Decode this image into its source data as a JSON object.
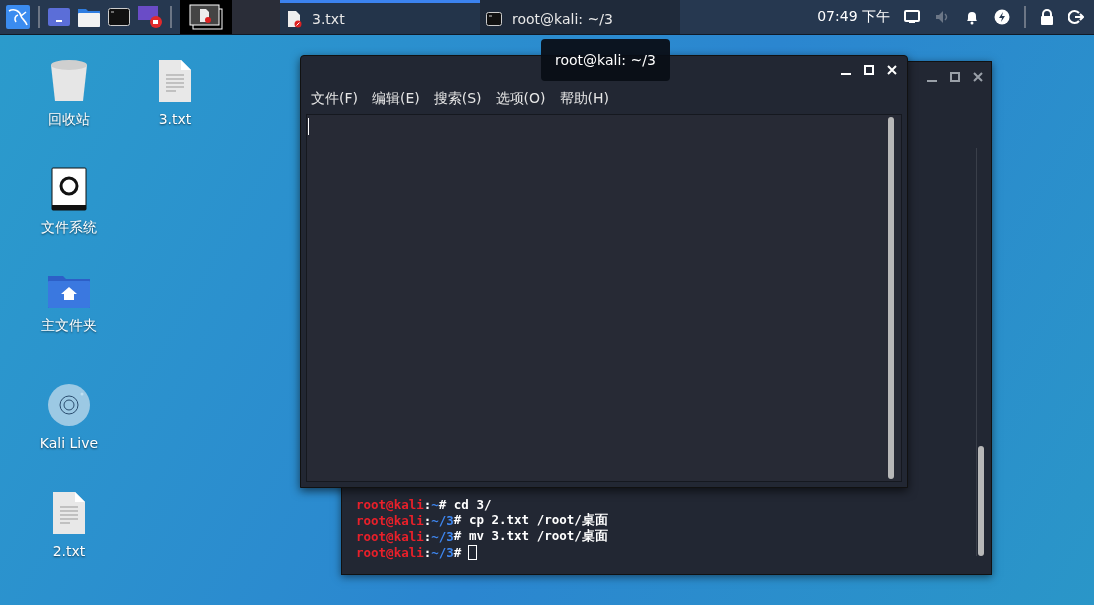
{
  "taskbar": {
    "tasks": [
      {
        "label": "3.txt",
        "kind": "text-file",
        "selected": true
      },
      {
        "label": "root@kali: ~/3",
        "kind": "terminal",
        "selected": false
      }
    ],
    "clock": "07:49 下午"
  },
  "desktop": {
    "columns": [
      [
        {
          "label": "回收站",
          "kind": "trash"
        },
        {
          "label": "文件系统",
          "kind": "drive"
        },
        {
          "label": "主文件夹",
          "kind": "home-folder"
        },
        {
          "label": "Kali Live",
          "kind": "disc"
        },
        {
          "label": "2.txt",
          "kind": "text-file"
        }
      ],
      [
        {
          "label": "3.txt",
          "kind": "text-file"
        }
      ]
    ]
  },
  "terminal": {
    "lines": [
      {
        "user": "root@kali",
        "sep": ":",
        "path": "~",
        "mark": "#",
        "command": " cd 3/"
      },
      {
        "user": "root@kali",
        "sep": ":",
        "path": "~/3",
        "mark": "#",
        "command": " cp 2.txt /root/桌面"
      },
      {
        "user": "root@kali",
        "sep": ":",
        "path": "~/3",
        "mark": "#",
        "command": " mv 3.txt /root/桌面"
      },
      {
        "user": "root@kali",
        "sep": ":",
        "path": "~/3",
        "mark": "#",
        "cursor": true
      }
    ]
  },
  "editor": {
    "menu": [
      "文件(F)",
      "编辑(E)",
      "搜索(S)",
      "选项(O)",
      "帮助(H)"
    ]
  },
  "tooltip": {
    "text": "root@kali: ~/3"
  }
}
